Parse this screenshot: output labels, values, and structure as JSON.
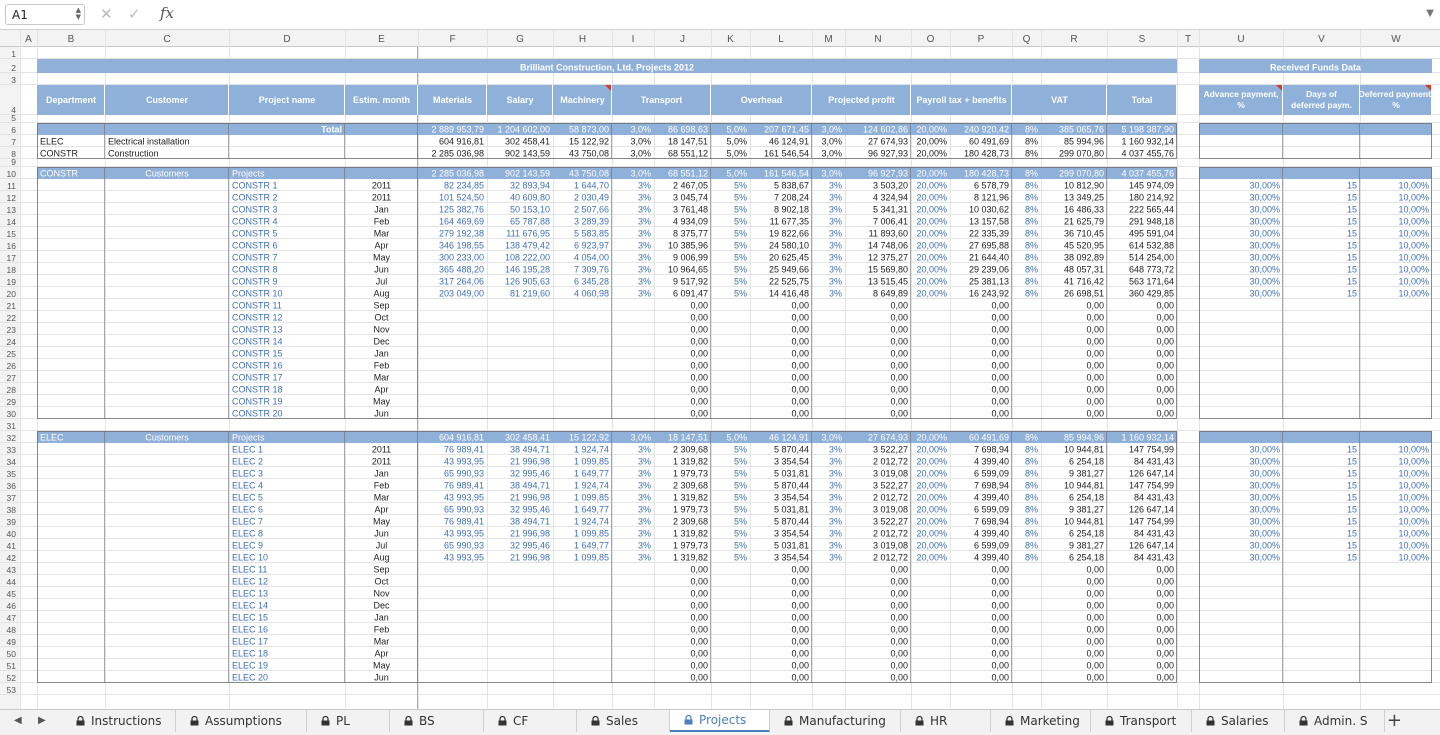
{
  "formula_bar": {
    "cell_ref": "A1",
    "formula": "",
    "cancel_icon": "x-icon",
    "confirm_icon": "check-icon",
    "fx": "fx"
  },
  "columns": [
    "",
    "A",
    "B",
    "C",
    "D",
    "E",
    "F",
    "G",
    "H",
    "I",
    "J",
    "K",
    "L",
    "M",
    "N",
    "O",
    "P",
    "Q",
    "R",
    "S",
    "T",
    "U",
    "V",
    "W"
  ],
  "sheet": {
    "title": "Brilliant Construction, Ltd. Projects 2012",
    "received_title": "Received Funds Data",
    "headers": {
      "B": "Department",
      "C": "Customer",
      "D": "Project name",
      "E": "Estim. month",
      "F": "Materials",
      "G": "Salary",
      "H": "Machinery",
      "IJ": "Transport",
      "KL": "Overhead",
      "MN": "Projected profit",
      "OP": "Payroll tax + benefits",
      "QR": "VAT",
      "S": "Total",
      "U": "Advance payment, %",
      "V": "Days of deferred paym.",
      "W": "Deferred payment, %"
    },
    "total_label": "Total",
    "total_row": [
      "2 889 953,79",
      "1 204 602,00",
      "58 873,00",
      "3,0%",
      "86 698,63",
      "5,0%",
      "207 671,45",
      "3,0%",
      "124 602,86",
      "20,00%",
      "240 920,42",
      "8%",
      "385 065,76",
      "5 198 387,90"
    ],
    "dept_rows": [
      {
        "code": "ELEC",
        "name": "Electrical installation",
        "vals": [
          "604 916,81",
          "302 458,41",
          "15 122,92",
          "3,0%",
          "18 147,51",
          "5,0%",
          "46 124,91",
          "3,0%",
          "27 674,93",
          "20,00%",
          "60 491,69",
          "8%",
          "85 994,96",
          "1 160 932,14"
        ]
      },
      {
        "code": "CONSTR",
        "name": "Construction",
        "vals": [
          "2 285 036,98",
          "902 143,59",
          "43 750,08",
          "3,0%",
          "68 551,12",
          "5,0%",
          "161 546,54",
          "3,0%",
          "96 927,93",
          "20,00%",
          "180 428,73",
          "8%",
          "299 070,80",
          "4 037 455,76"
        ]
      }
    ],
    "sections": [
      {
        "dept": "CONSTR",
        "customers": "Customers",
        "projects": "Projects",
        "sum": [
          "2 285 036,98",
          "902 143,59",
          "43 750,08",
          "3,0%",
          "68 551,12",
          "5,0%",
          "161 546,54",
          "3,0%",
          "96 927,93",
          "20,00%",
          "180 428,73",
          "8%",
          "299 070,80",
          "4 037 455,76"
        ],
        "rows": [
          {
            "name": "CONSTR 1",
            "month": "2011",
            "vals": [
              "82 234,85",
              "32 893,94",
              "1 644,70",
              "3%",
              "2 467,05",
              "5%",
              "5 838,67",
              "3%",
              "3 503,20",
              "20,00%",
              "6 578,79",
              "8%",
              "10 812,90",
              "145 974,09"
            ],
            "funds": [
              "30,00%",
              "15",
              "10,00%"
            ]
          },
          {
            "name": "CONSTR 2",
            "month": "2011",
            "vals": [
              "101 524,50",
              "40 609,80",
              "2 030,49",
              "3%",
              "3 045,74",
              "5%",
              "7 208,24",
              "3%",
              "4 324,94",
              "20,00%",
              "8 121,96",
              "8%",
              "13 349,25",
              "180 214,92"
            ],
            "funds": [
              "30,00%",
              "15",
              "10,00%"
            ]
          },
          {
            "name": "CONSTR 3",
            "month": "Jan",
            "vals": [
              "125 382,76",
              "50 153,10",
              "2 507,66",
              "3%",
              "3 761,48",
              "5%",
              "8 902,18",
              "3%",
              "5 341,31",
              "20,00%",
              "10 030,62",
              "8%",
              "16 486,33",
              "222 565,44"
            ],
            "funds": [
              "30,00%",
              "15",
              "10,00%"
            ]
          },
          {
            "name": "CONSTR 4",
            "month": "Feb",
            "vals": [
              "164 469,69",
              "65 787,88",
              "3 289,39",
              "3%",
              "4 934,09",
              "5%",
              "11 677,35",
              "3%",
              "7 006,41",
              "20,00%",
              "13 157,58",
              "8%",
              "21 625,79",
              "291 948,18"
            ],
            "funds": [
              "30,00%",
              "15",
              "10,00%"
            ]
          },
          {
            "name": "CONSTR 5",
            "month": "Mar",
            "vals": [
              "279 192,38",
              "111 676,95",
              "5 583,85",
              "3%",
              "8 375,77",
              "5%",
              "19 822,66",
              "3%",
              "11 893,60",
              "20,00%",
              "22 335,39",
              "8%",
              "36 710,45",
              "495 591,04"
            ],
            "funds": [
              "30,00%",
              "15",
              "10,00%"
            ]
          },
          {
            "name": "CONSTR 6",
            "month": "Apr",
            "vals": [
              "346 198,55",
              "138 479,42",
              "6 923,97",
              "3%",
              "10 385,96",
              "5%",
              "24 580,10",
              "3%",
              "14 748,06",
              "20,00%",
              "27 695,88",
              "8%",
              "45 520,95",
              "614 532,88"
            ],
            "funds": [
              "30,00%",
              "15",
              "10,00%"
            ]
          },
          {
            "name": "CONSTR 7",
            "month": "May",
            "vals": [
              "300 233,00",
              "108 222,00",
              "4 054,00",
              "3%",
              "9 006,99",
              "5%",
              "20 625,45",
              "3%",
              "12 375,27",
              "20,00%",
              "21 644,40",
              "8%",
              "38 092,89",
              "514 254,00"
            ],
            "funds": [
              "30,00%",
              "15",
              "10,00%"
            ]
          },
          {
            "name": "CONSTR 8",
            "month": "Jun",
            "vals": [
              "365 488,20",
              "146 195,28",
              "7 309,76",
              "3%",
              "10 964,65",
              "5%",
              "25 949,66",
              "3%",
              "15 569,80",
              "20,00%",
              "29 239,06",
              "8%",
              "48 057,31",
              "648 773,72"
            ],
            "funds": [
              "30,00%",
              "15",
              "10,00%"
            ]
          },
          {
            "name": "CONSTR 9",
            "month": "Jul",
            "vals": [
              "317 264,06",
              "126 905,63",
              "6 345,28",
              "3%",
              "9 517,92",
              "5%",
              "22 525,75",
              "3%",
              "13 515,45",
              "20,00%",
              "25 381,13",
              "8%",
              "41 716,42",
              "563 171,64"
            ],
            "funds": [
              "30,00%",
              "15",
              "10,00%"
            ]
          },
          {
            "name": "CONSTR 10",
            "month": "Aug",
            "vals": [
              "203 049,00",
              "81 219,60",
              "4 060,98",
              "3%",
              "6 091,47",
              "5%",
              "14 416,48",
              "3%",
              "8 649,89",
              "20,00%",
              "16 243,92",
              "8%",
              "26 698,51",
              "360 429,85"
            ],
            "funds": [
              "30,00%",
              "15",
              "10,00%"
            ]
          },
          {
            "name": "CONSTR 11",
            "month": "Sep"
          },
          {
            "name": "CONSTR 12",
            "month": "Oct"
          },
          {
            "name": "CONSTR 13",
            "month": "Nov"
          },
          {
            "name": "CONSTR 14",
            "month": "Dec"
          },
          {
            "name": "CONSTR 15",
            "month": "Jan"
          },
          {
            "name": "CONSTR 16",
            "month": "Feb"
          },
          {
            "name": "CONSTR 17",
            "month": "Mar"
          },
          {
            "name": "CONSTR 18",
            "month": "Apr"
          },
          {
            "name": "CONSTR 19",
            "month": "May"
          },
          {
            "name": "CONSTR 20",
            "month": "Jun"
          }
        ]
      },
      {
        "dept": "ELEC",
        "customers": "Customers",
        "projects": "Projects",
        "sum": [
          "604 916,81",
          "302 458,41",
          "15 122,92",
          "3,0%",
          "18 147,51",
          "5,0%",
          "46 124,91",
          "3,0%",
          "27 674,93",
          "20,00%",
          "60 491,69",
          "8%",
          "85 994,96",
          "1 160 932,14"
        ],
        "rows": [
          {
            "name": "ELEC 1",
            "month": "2011",
            "vals": [
              "76 989,41",
              "38 494,71",
              "1 924,74",
              "3%",
              "2 309,68",
              "5%",
              "5 870,44",
              "3%",
              "3 522,27",
              "20,00%",
              "7 698,94",
              "8%",
              "10 944,81",
              "147 754,99"
            ],
            "funds": [
              "30,00%",
              "15",
              "10,00%"
            ]
          },
          {
            "name": "ELEC 2",
            "month": "2011",
            "vals": [
              "43 993,95",
              "21 996,98",
              "1 099,85",
              "3%",
              "1 319,82",
              "5%",
              "3 354,54",
              "3%",
              "2 012,72",
              "20,00%",
              "4 399,40",
              "8%",
              "6 254,18",
              "84 431,43"
            ],
            "funds": [
              "30,00%",
              "15",
              "10,00%"
            ]
          },
          {
            "name": "ELEC 3",
            "month": "Jan",
            "vals": [
              "65 990,93",
              "32 995,46",
              "1 649,77",
              "3%",
              "1 979,73",
              "5%",
              "5 031,81",
              "3%",
              "3 019,08",
              "20,00%",
              "6 599,09",
              "8%",
              "9 381,27",
              "126 647,14"
            ],
            "funds": [
              "30,00%",
              "15",
              "10,00%"
            ]
          },
          {
            "name": "ELEC 4",
            "month": "Feb",
            "vals": [
              "76 989,41",
              "38 494,71",
              "1 924,74",
              "3%",
              "2 309,68",
              "5%",
              "5 870,44",
              "3%",
              "3 522,27",
              "20,00%",
              "7 698,94",
              "8%",
              "10 944,81",
              "147 754,99"
            ],
            "funds": [
              "30,00%",
              "15",
              "10,00%"
            ]
          },
          {
            "name": "ELEC 5",
            "month": "Mar",
            "vals": [
              "43 993,95",
              "21 996,98",
              "1 099,85",
              "3%",
              "1 319,82",
              "5%",
              "3 354,54",
              "3%",
              "2 012,72",
              "20,00%",
              "4 399,40",
              "8%",
              "6 254,18",
              "84 431,43"
            ],
            "funds": [
              "30,00%",
              "15",
              "10,00%"
            ]
          },
          {
            "name": "ELEC 6",
            "month": "Apr",
            "vals": [
              "65 990,93",
              "32 995,46",
              "1 649,77",
              "3%",
              "1 979,73",
              "5%",
              "5 031,81",
              "3%",
              "3 019,08",
              "20,00%",
              "6 599,09",
              "8%",
              "9 381,27",
              "126 647,14"
            ],
            "funds": [
              "30,00%",
              "15",
              "10,00%"
            ]
          },
          {
            "name": "ELEC 7",
            "month": "May",
            "vals": [
              "76 989,41",
              "38 494,71",
              "1 924,74",
              "3%",
              "2 309,68",
              "5%",
              "5 870,44",
              "3%",
              "3 522,27",
              "20,00%",
              "7 698,94",
              "8%",
              "10 944,81",
              "147 754,99"
            ],
            "funds": [
              "30,00%",
              "15",
              "10,00%"
            ]
          },
          {
            "name": "ELEC 8",
            "month": "Jun",
            "vals": [
              "43 993,95",
              "21 996,98",
              "1 099,85",
              "3%",
              "1 319,82",
              "5%",
              "3 354,54",
              "3%",
              "2 012,72",
              "20,00%",
              "4 399,40",
              "8%",
              "6 254,18",
              "84 431,43"
            ],
            "funds": [
              "30,00%",
              "15",
              "10,00%"
            ]
          },
          {
            "name": "ELEC 9",
            "month": "Jul",
            "vals": [
              "65 990,93",
              "32 995,46",
              "1 649,77",
              "3%",
              "1 979,73",
              "5%",
              "5 031,81",
              "3%",
              "3 019,08",
              "20,00%",
              "6 599,09",
              "8%",
              "9 381,27",
              "126 647,14"
            ],
            "funds": [
              "30,00%",
              "15",
              "10,00%"
            ]
          },
          {
            "name": "ELEC 10",
            "month": "Aug",
            "vals": [
              "43 993,95",
              "21 996,98",
              "1 099,85",
              "3%",
              "1 319,82",
              "5%",
              "3 354,54",
              "3%",
              "2 012,72",
              "20,00%",
              "4 399,40",
              "8%",
              "6 254,18",
              "84 431,43"
            ],
            "funds": [
              "30,00%",
              "15",
              "10,00%"
            ]
          },
          {
            "name": "ELEC 11",
            "month": "Sep"
          },
          {
            "name": "ELEC 12",
            "month": "Oct"
          },
          {
            "name": "ELEC 13",
            "month": "Nov"
          },
          {
            "name": "ELEC 14",
            "month": "Dec"
          },
          {
            "name": "ELEC 15",
            "month": "Jan"
          },
          {
            "name": "ELEC 16",
            "month": "Feb"
          },
          {
            "name": "ELEC 17",
            "month": "Mar"
          },
          {
            "name": "ELEC 18",
            "month": "Apr"
          },
          {
            "name": "ELEC 19",
            "month": "May"
          },
          {
            "name": "ELEC 20",
            "month": "Jun"
          }
        ]
      }
    ],
    "zero": "0,00"
  },
  "tabs": [
    "Instructions",
    "Assumptions",
    "PL",
    "BS",
    "CF",
    "Sales",
    "Projects",
    "Manufacturing",
    "HR",
    "Marketing",
    "Transport",
    "Salaries",
    "Admin. S"
  ],
  "active_tab": "Projects",
  "add_sheet": "+",
  "colors": {
    "header_fill": "#8fb0d8",
    "band_fill": "#8fb0d8",
    "link_blue": "#3f6fb5",
    "grid": "#e3e3e3"
  }
}
